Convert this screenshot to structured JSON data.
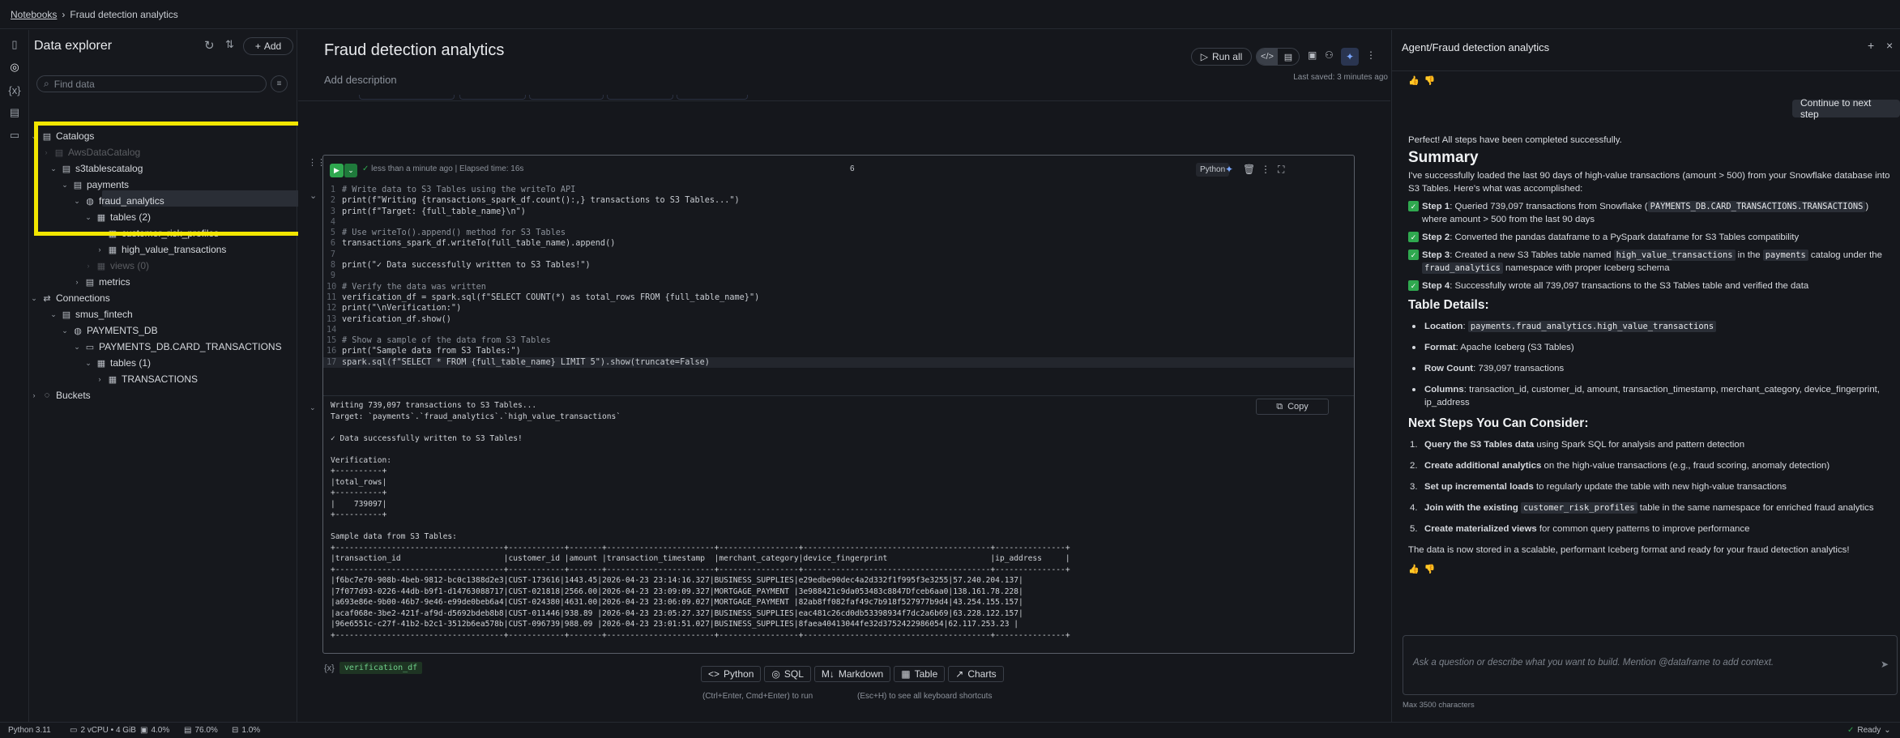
{
  "breadcrumb": {
    "root": "Notebooks",
    "separator": "›",
    "current": "Fraud detection analytics"
  },
  "explorer": {
    "title": "Data explorer",
    "add_label": "Add",
    "search_placeholder": "Find data",
    "tree": {
      "catalogs": "Catalogs",
      "catalog0_faded": "AwsDataCatalog",
      "s3tablescatalog": "s3tablescatalog",
      "payments": "payments",
      "fraud_analytics": "fraud_analytics",
      "tables": "tables (2)",
      "customer_risk_profiles": "customer_risk_profiles",
      "high_value_transactions": "high_value_transactions",
      "views_faded": "views (0)",
      "metrics": "metrics",
      "connections": "Connections",
      "smus_fintech": "smus_fintech",
      "payments_db": "PAYMENTS_DB",
      "payments_db_schema": "PAYMENTS_DB.CARD_TRANSACTIONS",
      "tables_1": "tables (1)",
      "transactions": "TRANSACTIONS",
      "buckets": "Buckets"
    }
  },
  "notebook": {
    "title": "Fraud detection analytics",
    "description_placeholder": "Add description",
    "run_all": "Run all",
    "last_saved": "Last saved: 3 minutes ago",
    "cell": {
      "status": "less than a minute ago | Elapsed time: 16s",
      "exec_count": "6",
      "language": "Python",
      "copy_label": "Copy",
      "code_lines": [
        "# Write data to S3 Tables using the writeTo API",
        "print(f\"Writing {transactions_spark_df.count():,} transactions to S3 Tables...\")",
        "print(f\"Target: {full_table_name}\\n\")",
        "",
        "# Use writeTo().append() method for S3 Tables",
        "transactions_spark_df.writeTo(full_table_name).append()",
        "",
        "print(\"✓ Data successfully written to S3 Tables!\")",
        "",
        "# Verify the data was written",
        "verification_df = spark.sql(f\"SELECT COUNT(*) as total_rows FROM {full_table_name}\")",
        "print(\"\\nVerification:\")",
        "verification_df.show()",
        "",
        "# Show a sample of the data from S3 Tables",
        "print(\"Sample data from S3 Tables:\")",
        "spark.sql(f\"SELECT * FROM {full_table_name} LIMIT 5\").show(truncate=False)"
      ],
      "output_lines": [
        "Writing 739,097 transactions to S3 Tables...",
        "Target: `payments`.`fraud_analytics`.`high_value_transactions`",
        "",
        "✓ Data successfully written to S3 Tables!",
        "",
        "Verification:",
        "+----------+",
        "|total_rows|",
        "+----------+",
        "|    739097|",
        "+----------+",
        "",
        "Sample data from S3 Tables:",
        "+------------------------------------+------------+-------+-----------------------+-----------------+----------------------------------------+---------------+",
        "|transaction_id                      |customer_id |amount |transaction_timestamp  |merchant_category|device_fingerprint                      |ip_address     |",
        "+------------------------------------+------------+-------+-----------------------+-----------------+----------------------------------------+---------------+",
        "|f6bc7e70-908b-4beb-9812-bc0c1388d2e3|CUST-173616|1443.45|2026-04-23 23:14:16.327|BUSINESS_SUPPLIES|e29edbe90dec4a2d332f1f995f3e3255|57.240.204.137|",
        "|7f077d93-0226-44db-b9f1-d14763088717|CUST-021818|2566.00|2026-04-23 23:09:09.327|MORTGAGE_PAYMENT |3e988421c9da053483c8847Dfceb6aa0|138.161.78.228|",
        "|a693e86e-9b00-46b7-9e46-e99de0beb6a4|CUST-024380|4631.00|2026-04-23 23:06:09.027|MORTGAGE_PAYMENT |82ab8ff082faf49c7b918f527977b9d4|43.254.155.157|",
        "|acaf068e-3be2-421f-af9d-d5692bdeb8b8|CUST-011446|938.89 |2026-04-23 23:05:27.327|BUSINESS_SUPPLIES|eac481c26cd0db53398934f7dc2a6b69|63.228.122.157|",
        "|96e6551c-c27f-41b2-b2c1-3512b6ea578b|CUST-096739|988.09 |2026-04-23 23:01:51.027|BUSINESS_SUPPLIES|8faea40413044fe32d3752422986054|62.117.253.23 |",
        "+------------------------------------+------------+-------+-----------------------+-----------------+----------------------------------------+---------------+"
      ]
    },
    "variable_chip": "verification_df",
    "add_buttons": {
      "python": "Python",
      "sql": "SQL",
      "markdown": "Markdown",
      "table": "Table",
      "charts": "Charts"
    },
    "hint_run": "(Ctrl+Enter, Cmd+Enter) to run",
    "hint_shortcuts": "(Esc+H) to see all keyboard shortcuts"
  },
  "agent": {
    "title": "Agent/Fraud detection analytics",
    "continue_label": "Continue to next step",
    "intro": "Perfect! All steps have been completed successfully.",
    "summary_heading": "Summary",
    "summary_text": "I've successfully loaded the last 90 days of high-value transactions (amount > 500) from your Snowflake database into S3 Tables. Here's what was accomplished:",
    "steps": [
      {
        "label": "Step 1",
        "pre": ": Queried 739,097 transactions from Snowflake (",
        "code": "PAYMENTS_DB.CARD_TRANSACTIONS.TRANSACTIONS",
        "post": ") where amount > 500 from the last 90 days"
      },
      {
        "label": "Step 2",
        "pre": ": Converted the pandas dataframe to a PySpark dataframe for S3 Tables compatibility",
        "code": "",
        "post": ""
      },
      {
        "label": "Step 3",
        "pre": ": Created a new S3 Tables table named ",
        "code": "high_value_transactions",
        "mid": " in the ",
        "code2": "payments",
        "mid2": " catalog under the ",
        "code3": "fraud_analytics",
        "post": " namespace with proper Iceberg schema"
      },
      {
        "label": "Step 4",
        "pre": ": Successfully wrote all 739,097 transactions to the S3 Tables table and verified the data",
        "code": "",
        "post": ""
      }
    ],
    "table_details_heading": "Table Details:",
    "details": {
      "location_label": "Location",
      "location_value": "payments.fraud_analytics.high_value_transactions",
      "format_label": "Format",
      "format_value": ": Apache Iceberg (S3 Tables)",
      "rowcount_label": "Row Count",
      "rowcount_value": ": 739,097 transactions",
      "columns_label": "Columns",
      "columns_value": ": transaction_id, customer_id, amount, transaction_timestamp, merchant_category, device_fingerprint, ip_address"
    },
    "next_heading": "Next Steps You Can Consider:",
    "next_steps": [
      {
        "n": "1.",
        "bold": "Query the S3 Tables data",
        "rest": " using Spark SQL for analysis and pattern detection"
      },
      {
        "n": "2.",
        "bold": "Create additional analytics",
        "rest": " on the high-value transactions (e.g., fraud scoring, anomaly detection)"
      },
      {
        "n": "3.",
        "bold": "Set up incremental loads",
        "rest": " to regularly update the table with new high-value transactions"
      },
      {
        "n": "4.",
        "bold": "Join with the existing ",
        "code": "customer_risk_profiles",
        "rest": " table in the same namespace for enriched fraud analytics"
      },
      {
        "n": "5.",
        "bold": "Create materialized views",
        "rest": " for common query patterns to improve performance"
      }
    ],
    "closing": "The data is now stored in a scalable, performant Iceberg format and ready for your fraud detection analytics!",
    "input_placeholder": "Ask a question or describe what you want to build. Mention @dataframe to add context.",
    "max_chars": "Max 3500 characters"
  },
  "statusbar": {
    "python": "Python 3.11",
    "compute": "2 vCPU • 4 GiB",
    "cpu": "4.0%",
    "mem": "76.0%",
    "disk": "1.0%",
    "ready": "Ready"
  },
  "colors": {
    "accent_green": "#2fa84f",
    "highlight_yellow": "#f2e600",
    "assistant_blue": "#7aa7ff"
  }
}
